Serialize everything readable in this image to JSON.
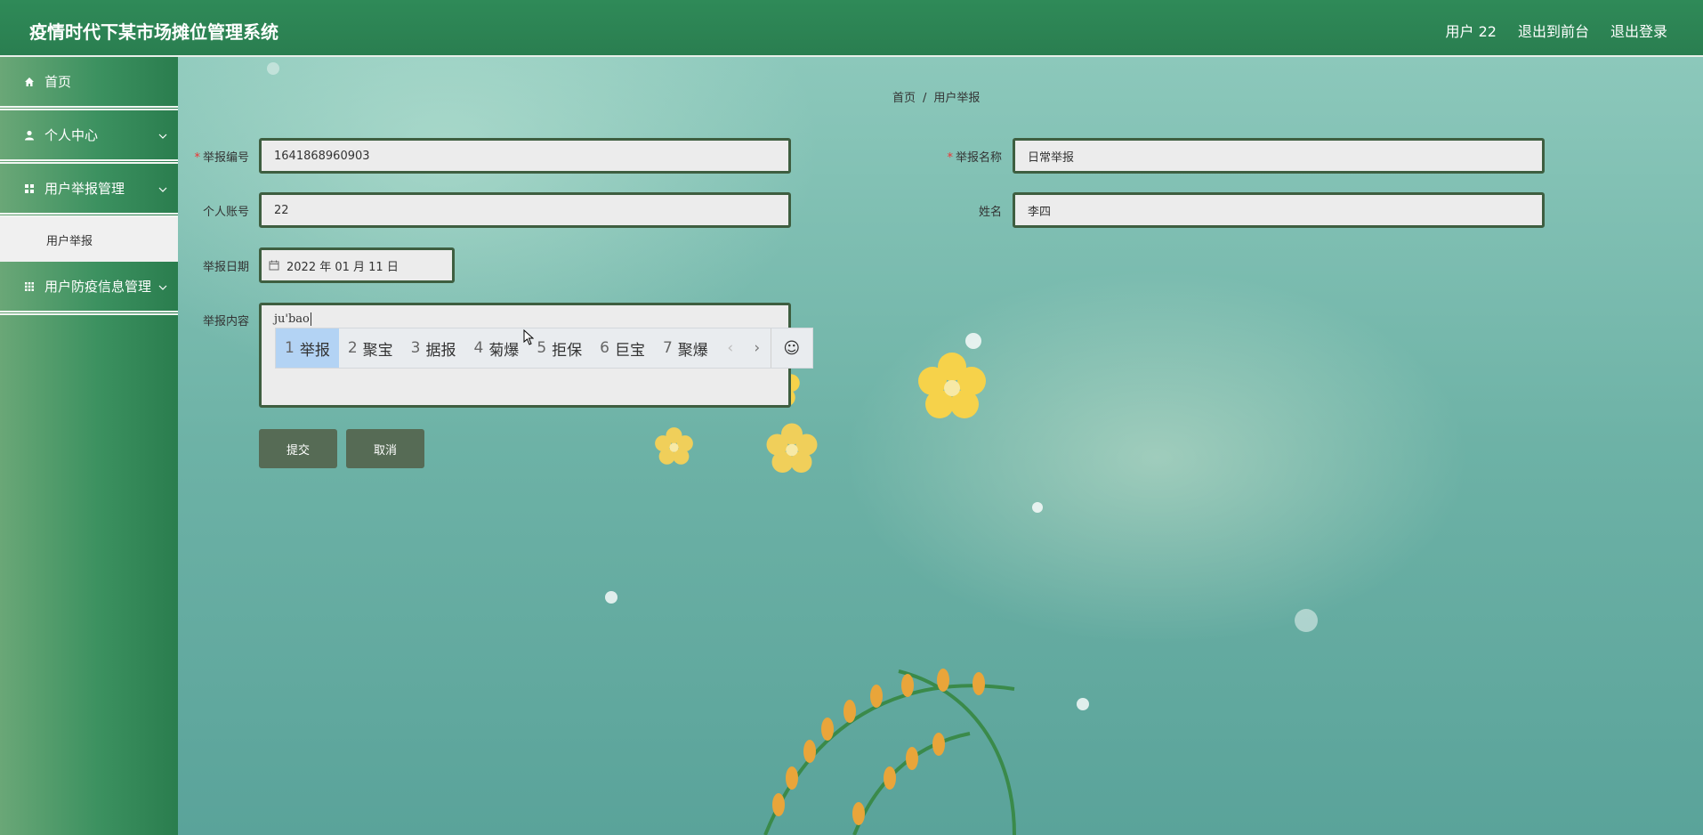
{
  "header": {
    "title": "疫情时代下某市场摊位管理系统",
    "user": "用户 22",
    "to_front": "退出到前台",
    "logout": "退出登录"
  },
  "sidebar": {
    "items": [
      {
        "label": "首页",
        "icon": "home-icon"
      },
      {
        "label": "个人中心",
        "icon": "user-icon"
      },
      {
        "label": "用户举报管理",
        "icon": "grid-icon"
      },
      {
        "label": "用户举报",
        "sub": true
      },
      {
        "label": "用户防疫信息管理",
        "icon": "grid-icon"
      }
    ]
  },
  "breadcrumb": {
    "home": "首页",
    "sep": "/",
    "current": "用户举报"
  },
  "form": {
    "report_no_label": "举报编号",
    "report_no_value": "1641868960903",
    "report_name_label": "举报名称",
    "report_name_value": "日常举报",
    "account_label": "个人账号",
    "account_value": "22",
    "name_label": "姓名",
    "name_value": "李四",
    "date_label": "举报日期",
    "date_value": "2022 年 01 月 11 日",
    "content_label": "举报内容",
    "content_value": "ju'bao",
    "required_mark": "*",
    "submit": "提交",
    "cancel": "取消"
  },
  "ime": {
    "candidates": [
      {
        "n": "1",
        "text": "举报",
        "selected": true
      },
      {
        "n": "2",
        "text": "聚宝"
      },
      {
        "n": "3",
        "text": "据报"
      },
      {
        "n": "4",
        "text": "菊爆"
      },
      {
        "n": "5",
        "text": "拒保"
      },
      {
        "n": "6",
        "text": "巨宝"
      },
      {
        "n": "7",
        "text": "聚爆"
      }
    ],
    "prev": "‹",
    "next": "›",
    "emoji": "☺"
  }
}
